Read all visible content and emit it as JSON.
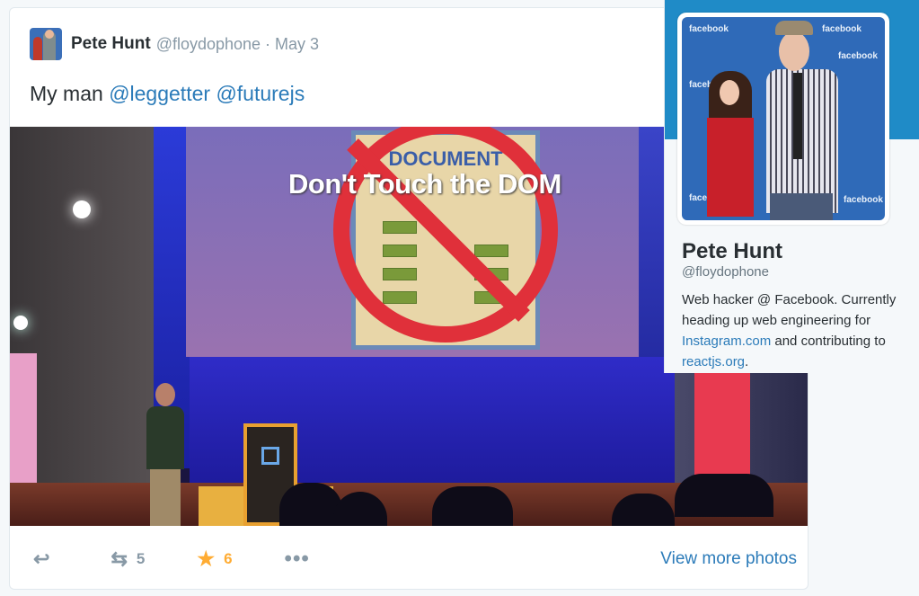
{
  "tweet": {
    "fullname": "Pete Hunt",
    "username": "@floydophone",
    "separator": "·",
    "date": "May 3",
    "text_prefix": "My man",
    "mention1": "@leggetter",
    "mention2": "@futurejs",
    "photo": {
      "slide_title": "DOCUMENT",
      "slide_text": "Don't Touch the DOM"
    },
    "actions": {
      "retweet_count": "5",
      "favorite_count": "6",
      "view_more": "View more photos"
    }
  },
  "profile_card": {
    "name": "Pete Hunt",
    "handle": "@floydophone",
    "bio_text": "Web hacker @ Facebook. Currently heading up web engineering for",
    "bio_link1": "Instagram.com",
    "bio_mid": "and contributing to",
    "bio_link2": "reactjs.org",
    "bio_end": ".",
    "avatar_backdrop_text": "facebook"
  },
  "colors": {
    "link": "#2b7bb9",
    "favorite": "#ffac33",
    "banner": "#1f8bc7"
  },
  "icons": [
    "reply-icon",
    "retweet-icon",
    "star-icon",
    "more-icon"
  ]
}
